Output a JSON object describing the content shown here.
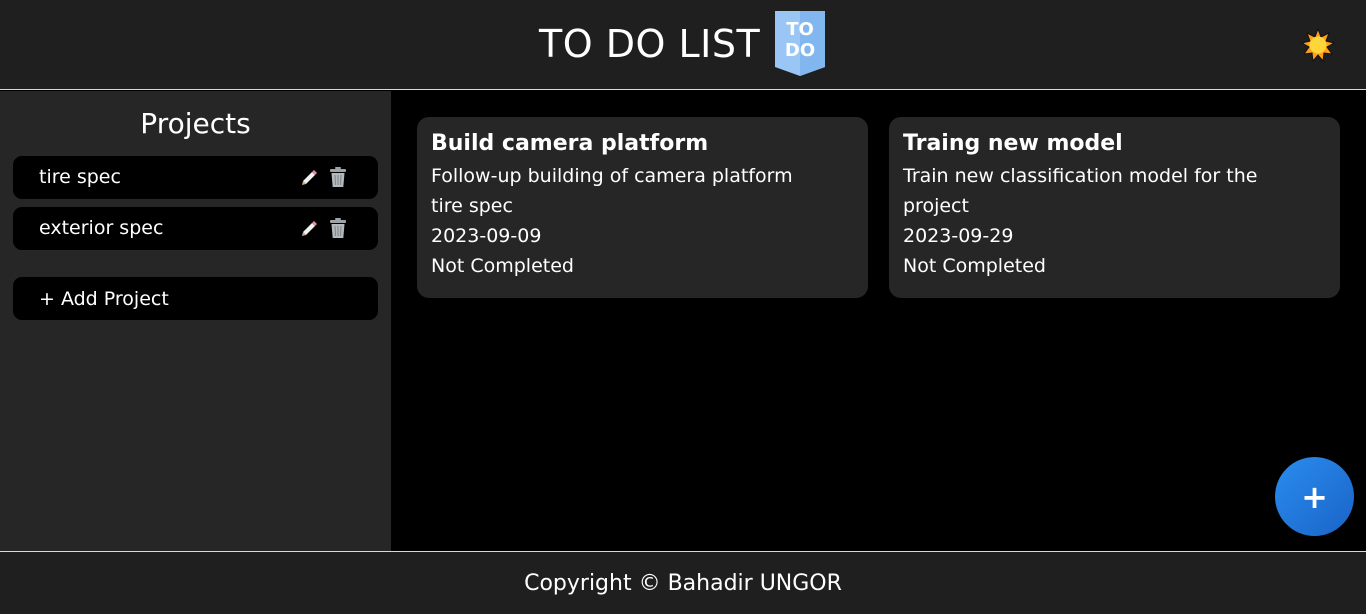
{
  "header": {
    "title": "TO DO LIST",
    "logo_text_top": "TO",
    "logo_text_bottom": "DO",
    "theme_toggle_icon": "sun-icon"
  },
  "sidebar": {
    "title": "Projects",
    "projects": [
      {
        "name": "tire spec",
        "edit_icon": "pencil-icon",
        "delete_icon": "trash-icon"
      },
      {
        "name": "exterior spec",
        "edit_icon": "pencil-icon",
        "delete_icon": "trash-icon"
      }
    ],
    "add_project_label": "+ Add Project"
  },
  "tasks": [
    {
      "title": "Build camera platform",
      "description": "Follow-up building of camera platform",
      "project": "tire spec",
      "date": "2023-09-09",
      "status": "Not Completed"
    },
    {
      "title": "Traing new model",
      "description": "Train new classification model for the project",
      "date": "2023-09-29",
      "status": "Not Completed"
    }
  ],
  "fab": {
    "label": "+"
  },
  "footer": {
    "text": "Copyright © Bahadir UNGOR"
  },
  "colors": {
    "header_bg": "#1f1f1f",
    "sidebar_bg": "#262626",
    "card_bg": "#262626",
    "accent": "#1f78de",
    "logo": "#9ac6f5"
  }
}
